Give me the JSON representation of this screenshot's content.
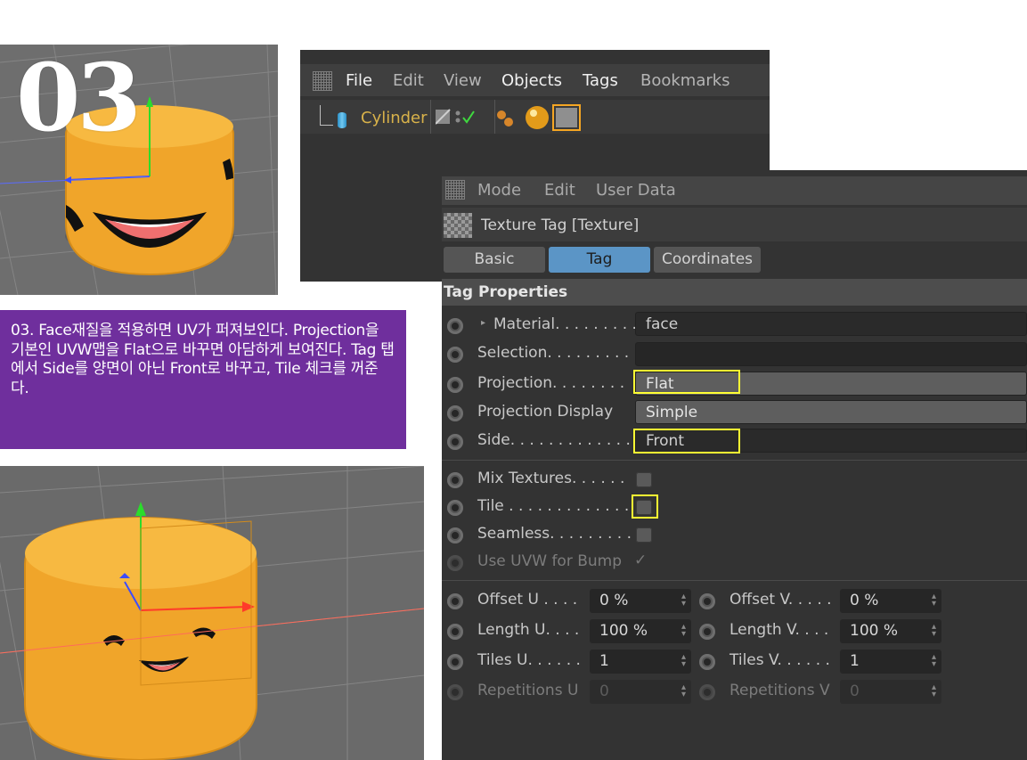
{
  "step_number": "03",
  "caption": "03. Face재질을 적용하면 UV가 퍼져보인다. Projection을 기본인 UVW맵을 Flat으로 바꾸면 아담하게 보여진다. Tag 탭에서 Side를 양면이 아닌 Front로 바꾸고, Tile 체크를 꺼준다.",
  "object_manager": {
    "menu": [
      "File",
      "Edit",
      "View",
      "Objects",
      "Tags",
      "Bookmarks"
    ],
    "object_name": "Cylinder"
  },
  "attribute_manager": {
    "menu": [
      "Mode",
      "Edit",
      "User Data"
    ],
    "title": "Texture Tag [Texture]",
    "tabs": [
      "Basic",
      "Tag",
      "Coordinates"
    ],
    "active_tab": "Tag",
    "section": "Tag Properties",
    "fields": {
      "material_label": "Material. . . . . . . . .",
      "material_value": "face",
      "selection_label": "Selection. . . . . . . . .",
      "selection_value": "",
      "projection_label": "Projection. . . . . . . .",
      "projection_value": "Flat",
      "projection_display_label": "Projection Display",
      "projection_display_value": "Simple",
      "side_label": "Side. . . . . . . . . . . . .",
      "side_value": "Front",
      "mix_textures_label": "Mix Textures. . . . . .",
      "tile_label": "Tile . . . . . . . . . . . . .",
      "seamless_label": "Seamless. . . . . . . . .",
      "use_uvw_label": "Use UVW for Bump",
      "offset_u_label": "Offset U . . . .",
      "offset_u_value": "0 %",
      "offset_v_label": "Offset V. . . . .",
      "offset_v_value": "0 %",
      "length_u_label": "Length U. . . .",
      "length_u_value": "100 %",
      "length_v_label": "Length V. . . .",
      "length_v_value": "100 %",
      "tiles_u_label": "Tiles U. . . . . .",
      "tiles_u_value": "1",
      "tiles_v_label": "Tiles V. . . . . .",
      "tiles_v_value": "1",
      "repetitions_u_label": "Repetitions U",
      "repetitions_u_value": "0",
      "repetitions_v_label": "Repetitions V",
      "repetitions_v_value": "0"
    },
    "mix_textures_checked": false,
    "tile_checked": false,
    "seamless_checked": false,
    "use_uvw_checked": true
  },
  "colors": {
    "caption_bg": "#6f2f9d",
    "highlight": "#ffff33",
    "active_tab": "#5b95c6",
    "object_name": "#d8b24a"
  }
}
